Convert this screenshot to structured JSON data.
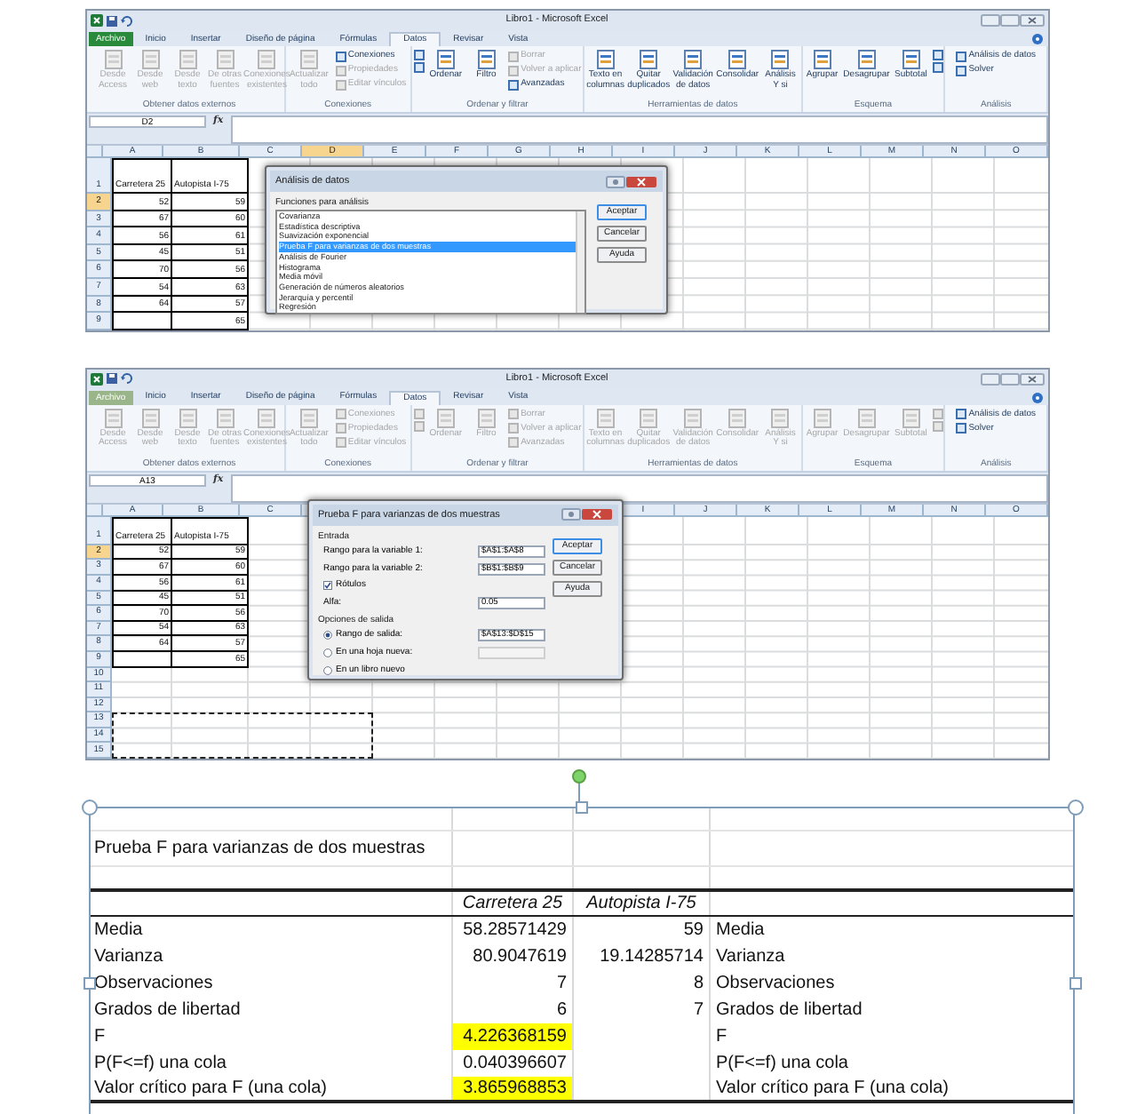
{
  "windows": [
    {
      "title": "Libro1 - Microsoft Excel",
      "file_tab": {
        "label": "Archivo",
        "disabled": false
      },
      "tabs": [
        {
          "label": "Inicio",
          "selected": false
        },
        {
          "label": "Insertar",
          "selected": false
        },
        {
          "label": "Diseño de página",
          "selected": false
        },
        {
          "label": "Fórmulas",
          "selected": false
        },
        {
          "label": "Datos",
          "selected": true
        },
        {
          "label": "Revisar",
          "selected": false
        },
        {
          "label": "Vista",
          "selected": false
        }
      ],
      "ribbon_groups": [
        {
          "label": "Obtener datos externos",
          "items": [
            {
              "kind": "large",
              "label": "Desde Access",
              "disabled": true
            },
            {
              "kind": "large",
              "label": "Desde web",
              "disabled": true
            },
            {
              "kind": "large",
              "label": "Desde texto",
              "disabled": true
            },
            {
              "kind": "large",
              "label": "De otras fuentes",
              "disabled": true
            },
            {
              "kind": "large",
              "label": "Conexiones existentes",
              "disabled": true
            }
          ]
        },
        {
          "label": "Conexiones",
          "items": [
            {
              "kind": "large",
              "label": "Actualizar todo",
              "disabled": true
            },
            {
              "kind": "stack",
              "buttons": [
                {
                  "label": "Conexiones",
                  "disabled": false
                },
                {
                  "label": "Propiedades",
                  "disabled": true
                },
                {
                  "label": "Editar vínculos",
                  "disabled": true
                }
              ]
            }
          ]
        },
        {
          "label": "Ordenar y filtrar",
          "items": [
            {
              "kind": "stack",
              "buttons": [
                {
                  "disabled": false
                },
                {
                  "disabled": false
                }
              ]
            },
            {
              "kind": "large",
              "label": "Ordenar",
              "disabled": false
            },
            {
              "kind": "large",
              "label": "Filtro",
              "disabled": false
            },
            {
              "kind": "stack",
              "buttons": [
                {
                  "label": "Borrar",
                  "disabled": true
                },
                {
                  "label": "Volver a aplicar",
                  "disabled": true
                },
                {
                  "label": "Avanzadas",
                  "disabled": false
                }
              ]
            }
          ]
        },
        {
          "label": "Herramientas de datos",
          "items": [
            {
              "kind": "large",
              "label": "Texto en columnas",
              "disabled": false
            },
            {
              "kind": "large",
              "label": "Quitar duplicados",
              "disabled": false
            },
            {
              "kind": "large",
              "label": "Validación de datos",
              "disabled": false
            },
            {
              "kind": "large",
              "label": "Consolidar",
              "disabled": false
            },
            {
              "kind": "large",
              "label": "Análisis Y si",
              "disabled": false
            }
          ]
        },
        {
          "label": "Esquema",
          "items": [
            {
              "kind": "large",
              "label": "Agrupar",
              "disabled": false
            },
            {
              "kind": "large",
              "label": "Desagrupar",
              "disabled": false
            },
            {
              "kind": "large",
              "label": "Subtotal",
              "disabled": false
            },
            {
              "kind": "stack",
              "buttons": [
                {
                  "disabled": false
                },
                {
                  "disabled": false
                }
              ]
            }
          ]
        },
        {
          "label": "Análisis",
          "items": [
            {
              "kind": "stack",
              "buttons": [
                {
                  "label": "Análisis de datos",
                  "disabled": false
                },
                {
                  "label": "Solver",
                  "disabled": false
                }
              ]
            }
          ]
        }
      ],
      "name_box": "D2",
      "formula_label": "fx",
      "sheet": {
        "columns": [
          {
            "label": "A",
            "selected": false
          },
          {
            "label": "B",
            "selected": false
          },
          {
            "label": "C",
            "selected": false
          },
          {
            "label": "D",
            "selected": true
          },
          {
            "label": "E",
            "selected": false
          },
          {
            "label": "F",
            "selected": false
          },
          {
            "label": "G",
            "selected": false
          },
          {
            "label": "H",
            "selected": false
          },
          {
            "label": "I",
            "selected": false
          },
          {
            "label": "J",
            "selected": false
          },
          {
            "label": "K",
            "selected": false
          },
          {
            "label": "L",
            "selected": false
          },
          {
            "label": "M",
            "selected": false
          },
          {
            "label": "N",
            "selected": false
          },
          {
            "label": "O",
            "selected": false
          }
        ],
        "rows": [
          {
            "label": "1",
            "selected": false,
            "cells": [
              {
                "kind": "text",
                "text": "Carretera 25"
              },
              {
                "kind": "text",
                "text": "Autopista I-75"
              }
            ]
          },
          {
            "label": "2",
            "selected": true,
            "cells": [
              {
                "kind": "number",
                "text": "52"
              },
              {
                "kind": "number",
                "text": "59"
              }
            ]
          },
          {
            "label": "3",
            "selected": false,
            "cells": [
              {
                "kind": "number",
                "text": "67"
              },
              {
                "kind": "number",
                "text": "60"
              }
            ]
          },
          {
            "label": "4",
            "selected": false,
            "cells": [
              {
                "kind": "number",
                "text": "56"
              },
              {
                "kind": "number",
                "text": "61"
              }
            ]
          },
          {
            "label": "5",
            "selected": false,
            "cells": [
              {
                "kind": "number",
                "text": "45"
              },
              {
                "kind": "number",
                "text": "51"
              }
            ]
          },
          {
            "label": "6",
            "selected": false,
            "cells": [
              {
                "kind": "number",
                "text": "70"
              },
              {
                "kind": "number",
                "text": "56"
              }
            ]
          },
          {
            "label": "7",
            "selected": false,
            "cells": [
              {
                "kind": "number",
                "text": "54"
              },
              {
                "kind": "number",
                "text": "63"
              }
            ]
          },
          {
            "label": "8",
            "selected": false,
            "cells": [
              {
                "kind": "number",
                "text": "64"
              },
              {
                "kind": "number",
                "text": "57"
              }
            ]
          },
          {
            "label": "9",
            "selected": false,
            "cells": [
              {
                "kind": "blank"
              },
              {
                "kind": "number",
                "text": "65"
              }
            ]
          }
        ]
      },
      "dialog": {
        "kind": "list",
        "title": "Análisis de datos",
        "list_label": "Funciones para análisis",
        "items": [
          {
            "label": "Covarianza",
            "selected": false
          },
          {
            "label": "Estadística descriptiva",
            "selected": false
          },
          {
            "label": "Suavización exponencial",
            "selected": false
          },
          {
            "label": "Prueba F para varianzas de dos muestras",
            "selected": true
          },
          {
            "label": "Análisis de Fourier",
            "selected": false
          },
          {
            "label": "Histograma",
            "selected": false
          },
          {
            "label": "Media móvil",
            "selected": false
          },
          {
            "label": "Generación de números aleatorios",
            "selected": false
          },
          {
            "label": "Jerarquía y percentil",
            "selected": false
          },
          {
            "label": "Regresión",
            "selected": false
          }
        ],
        "buttons": [
          {
            "label": "Aceptar",
            "default": true
          },
          {
            "label": "Cancelar",
            "default": false
          },
          {
            "label": "Ayuda",
            "default": false
          }
        ]
      }
    },
    {
      "title": "Libro1 - Microsoft Excel",
      "file_tab": {
        "label": "Archivo",
        "disabled": true
      },
      "tabs": [
        {
          "label": "Inicio",
          "selected": false
        },
        {
          "label": "Insertar",
          "selected": false
        },
        {
          "label": "Diseño de página",
          "selected": false
        },
        {
          "label": "Fórmulas",
          "selected": false
        },
        {
          "label": "Datos",
          "selected": true
        },
        {
          "label": "Revisar",
          "selected": false
        },
        {
          "label": "Vista",
          "selected": false
        }
      ],
      "ribbon_groups": [
        {
          "label": "Obtener datos externos",
          "items": [
            {
              "kind": "large",
              "label": "Desde Access",
              "disabled": true
            },
            {
              "kind": "large",
              "label": "Desde web",
              "disabled": true
            },
            {
              "kind": "large",
              "label": "Desde texto",
              "disabled": true
            },
            {
              "kind": "large",
              "label": "De otras fuentes",
              "disabled": true
            },
            {
              "kind": "large",
              "label": "Conexiones existentes",
              "disabled": true
            }
          ]
        },
        {
          "label": "Conexiones",
          "items": [
            {
              "kind": "large",
              "label": "Actualizar todo",
              "disabled": true
            },
            {
              "kind": "stack",
              "buttons": [
                {
                  "label": "Conexiones",
                  "disabled": true
                },
                {
                  "label": "Propiedades",
                  "disabled": true
                },
                {
                  "label": "Editar vínculos",
                  "disabled": true
                }
              ]
            }
          ]
        },
        {
          "label": "Ordenar y filtrar",
          "items": [
            {
              "kind": "stack",
              "buttons": [
                {
                  "disabled": true
                },
                {
                  "disabled": true
                }
              ]
            },
            {
              "kind": "large",
              "label": "Ordenar",
              "disabled": true
            },
            {
              "kind": "large",
              "label": "Filtro",
              "disabled": true
            },
            {
              "kind": "stack",
              "buttons": [
                {
                  "label": "Borrar",
                  "disabled": true
                },
                {
                  "label": "Volver a aplicar",
                  "disabled": true
                },
                {
                  "label": "Avanzadas",
                  "disabled": true
                }
              ]
            }
          ]
        },
        {
          "label": "Herramientas de datos",
          "items": [
            {
              "kind": "large",
              "label": "Texto en columnas",
              "disabled": true
            },
            {
              "kind": "large",
              "label": "Quitar duplicados",
              "disabled": true
            },
            {
              "kind": "large",
              "label": "Validación de datos",
              "disabled": true
            },
            {
              "kind": "large",
              "label": "Consolidar",
              "disabled": true
            },
            {
              "kind": "large",
              "label": "Análisis Y si",
              "disabled": true
            }
          ]
        },
        {
          "label": "Esquema",
          "items": [
            {
              "kind": "large",
              "label": "Agrupar",
              "disabled": true
            },
            {
              "kind": "large",
              "label": "Desagrupar",
              "disabled": true
            },
            {
              "kind": "large",
              "label": "Subtotal",
              "disabled": true
            },
            {
              "kind": "stack",
              "buttons": [
                {
                  "disabled": true
                },
                {
                  "disabled": true
                }
              ]
            }
          ]
        },
        {
          "label": "Análisis",
          "items": [
            {
              "kind": "stack",
              "buttons": [
                {
                  "label": "Análisis de datos",
                  "disabled": false
                },
                {
                  "label": "Solver",
                  "disabled": false
                }
              ]
            }
          ]
        }
      ],
      "name_box": "A13",
      "formula_label": "fx",
      "sheet": {
        "columns": [
          {
            "label": "A",
            "selected": false
          },
          {
            "label": "B",
            "selected": false
          },
          {
            "label": "C",
            "selected": false
          },
          {
            "kind": "covered"
          },
          {
            "kind": "covered"
          },
          {
            "kind": "covered"
          },
          {
            "kind": "covered"
          },
          {
            "kind": "covered"
          },
          {
            "label": "I",
            "selected": false
          },
          {
            "label": "J",
            "selected": false
          },
          {
            "label": "K",
            "selected": false
          },
          {
            "label": "L",
            "selected": false
          },
          {
            "label": "M",
            "selected": false
          },
          {
            "label": "N",
            "selected": false
          },
          {
            "label": "O",
            "selected": false
          }
        ],
        "rows": [
          {
            "label": "1",
            "selected": false,
            "cells": [
              {
                "kind": "text",
                "text": "Carretera 25"
              },
              {
                "kind": "text",
                "text": "Autopista I-75"
              }
            ]
          },
          {
            "label": "2",
            "selected": true,
            "cells": [
              {
                "kind": "number",
                "text": "52"
              },
              {
                "kind": "number",
                "text": "59"
              }
            ]
          },
          {
            "label": "3",
            "selected": false,
            "cells": [
              {
                "kind": "number",
                "text": "67"
              },
              {
                "kind": "number",
                "text": "60"
              }
            ]
          },
          {
            "label": "4",
            "selected": false,
            "cells": [
              {
                "kind": "number",
                "text": "56"
              },
              {
                "kind": "number",
                "text": "61"
              }
            ]
          },
          {
            "label": "5",
            "selected": false,
            "cells": [
              {
                "kind": "number",
                "text": "45"
              },
              {
                "kind": "number",
                "text": "51"
              }
            ]
          },
          {
            "label": "6",
            "selected": false,
            "cells": [
              {
                "kind": "number",
                "text": "70"
              },
              {
                "kind": "number",
                "text": "56"
              }
            ]
          },
          {
            "label": "7",
            "selected": false,
            "cells": [
              {
                "kind": "number",
                "text": "54"
              },
              {
                "kind": "number",
                "text": "63"
              }
            ]
          },
          {
            "label": "8",
            "selected": false,
            "cells": [
              {
                "kind": "number",
                "text": "64"
              },
              {
                "kind": "number",
                "text": "57"
              }
            ]
          },
          {
            "label": "9",
            "selected": false,
            "cells": [
              {
                "kind": "blank"
              },
              {
                "kind": "number",
                "text": "65"
              }
            ]
          },
          {
            "label": "10",
            "selected": false,
            "cells": []
          },
          {
            "label": "11",
            "selected": false,
            "cells": []
          },
          {
            "label": "12",
            "selected": false,
            "cells": []
          },
          {
            "label": "13",
            "selected": false,
            "cells": [
              {
                "kind": "range"
              },
              {
                "kind": "range"
              },
              {
                "kind": "range"
              },
              {
                "kind": "range"
              }
            ]
          },
          {
            "label": "14",
            "selected": false,
            "cells": [
              {
                "kind": "range"
              },
              {
                "kind": "range"
              },
              {
                "kind": "range"
              },
              {
                "kind": "range"
              }
            ]
          },
          {
            "label": "15",
            "selected": false,
            "cells": [
              {
                "kind": "range"
              },
              {
                "kind": "range"
              },
              {
                "kind": "range"
              },
              {
                "kind": "range"
              }
            ]
          }
        ]
      },
      "dialog": {
        "kind": "form",
        "title": "Prueba F para varianzas de dos muestras",
        "sections": [
          {
            "label": "Entrada",
            "rows": [
              {
                "kind": "field",
                "label": "Rango para la variable 1:",
                "value": "$A$1:$A$8"
              },
              {
                "kind": "field",
                "label": "Rango para la variable 2:",
                "value": "$B$1:$B$9"
              },
              {
                "kind": "checkbox",
                "label": "Rótulos",
                "checked": true
              },
              {
                "kind": "field",
                "label": "Alfa:",
                "value": "0.05"
              }
            ]
          },
          {
            "label": "Opciones de salida",
            "rows": [
              {
                "kind": "radio",
                "label": "Rango de salida:",
                "selected": true,
                "value": "$A$13:$D$15"
              },
              {
                "kind": "radio",
                "label": "En una hoja nueva:",
                "selected": false,
                "blank_field": true
              },
              {
                "kind": "radio",
                "label": "En un libro nuevo",
                "selected": false
              }
            ]
          }
        ],
        "buttons": [
          {
            "label": "Aceptar",
            "default": true
          },
          {
            "label": "Cancelar",
            "default": false
          },
          {
            "label": "Ayuda",
            "default": false
          }
        ]
      }
    }
  ],
  "output_table": {
    "title": "Prueba F para varianzas de dos muestras",
    "columns": [
      "Carretera 25",
      "Autopista I-75"
    ],
    "rows": [
      {
        "label": "Media",
        "value_1": {
          "text": "58.28571429",
          "highlighted": false
        },
        "value_2": {
          "text": "59",
          "highlighted": false
        },
        "label_right": "Media"
      },
      {
        "label": "Varianza",
        "value_1": {
          "text": "80.9047619",
          "highlighted": false
        },
        "value_2": {
          "text": "19.14285714",
          "highlighted": false
        },
        "label_right": "Varianza"
      },
      {
        "label": "Observaciones",
        "value_1": {
          "text": "7",
          "highlighted": false
        },
        "value_2": {
          "text": "8",
          "highlighted": false
        },
        "label_right": "Observaciones"
      },
      {
        "label": "Grados de libertad",
        "value_1": {
          "text": "6",
          "highlighted": false
        },
        "value_2": {
          "text": "7",
          "highlighted": false
        },
        "label_right": "Grados de libertad"
      },
      {
        "label": "F",
        "value_1": {
          "text": "4.226368159",
          "highlighted": true
        },
        "label_right": "F"
      },
      {
        "label": "P(F<=f) una cola",
        "value_1": {
          "text": "0.040396607",
          "highlighted": false
        },
        "label_right": "P(F<=f) una cola"
      },
      {
        "label": "Valor crítico para F (una cola)",
        "value_1": {
          "text": "3.865968853",
          "highlighted": true
        },
        "label_right": "Valor crítico para F (una cola)"
      }
    ]
  }
}
